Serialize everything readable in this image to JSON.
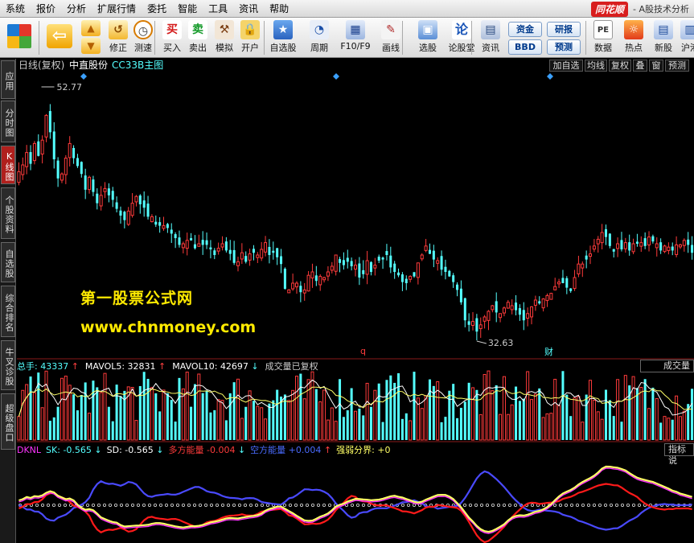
{
  "menu": [
    "系统",
    "报价",
    "分析",
    "扩展行情",
    "委托",
    "智能",
    "工具",
    "资讯",
    "帮助"
  ],
  "brand": {
    "logo": "同花顺",
    "subtitle": "- A股技术分析"
  },
  "toolbar": {
    "buttons": [
      {
        "label": "修正",
        "icon": "undo-icon"
      },
      {
        "label": "测速",
        "icon": "clock-icon"
      },
      {
        "label": "买入",
        "icon": "buy-icon",
        "glyph": "买"
      },
      {
        "label": "卖出",
        "icon": "sell-icon",
        "glyph": "卖"
      },
      {
        "label": "模拟",
        "icon": "hammer-icon"
      },
      {
        "label": "开户",
        "icon": "lock-icon"
      },
      {
        "label": "自选股",
        "icon": "star-folder-icon"
      },
      {
        "label": "周期",
        "icon": "cycle-icon"
      },
      {
        "label": "F10/F9",
        "icon": "f10-icon"
      },
      {
        "label": "画线",
        "icon": "pen-icon"
      },
      {
        "label": "选股",
        "icon": "monitor-icon"
      },
      {
        "label": "论股堂",
        "icon": "lun-icon",
        "glyph": "论"
      },
      {
        "label": "资讯",
        "icon": "info-icon"
      },
      {
        "label": "数据",
        "icon": "pe-icon",
        "glyph": "PE"
      },
      {
        "label": "热点",
        "icon": "hot-icon"
      },
      {
        "label": "新股",
        "icon": "ipo-icon"
      },
      {
        "label": "沪港",
        "icon": "hk-icon"
      }
    ],
    "small_buttons": [
      "资金",
      "BBD",
      "研报",
      "预测"
    ]
  },
  "left_tabs": [
    "应用",
    "分时图",
    "K线图",
    "个股资料",
    "自选股",
    "综合排名",
    "牛叉诊股",
    "超级盘口"
  ],
  "chart_header": {
    "period": "日线(复权)",
    "stock": "中直股份",
    "formula": "CC33B主图",
    "right_buttons": [
      "加自选",
      "均线",
      "复权",
      "叠",
      "窗",
      "预测"
    ]
  },
  "watermark": {
    "line1": "第一股票公式网",
    "line2": "www.chnmoney.com"
  },
  "volume_panel": {
    "items": [
      {
        "label": "总手: 43337",
        "arrow": "↑"
      },
      {
        "label": "MAVOL5: 32831",
        "arrow": "↑"
      },
      {
        "label": "MAVOL10: 42697",
        "arrow": "↓"
      },
      {
        "label": "成交量已复权",
        "arrow": ""
      }
    ],
    "tag": "成交量"
  },
  "dknl_panel": {
    "items": [
      {
        "label": "DKNL",
        "value": ""
      },
      {
        "label": "SK: ",
        "value": "-0.565",
        "arrow": "↓"
      },
      {
        "label": "SD: ",
        "value": "-0.565",
        "arrow": "↓"
      },
      {
        "label": "多方能量 ",
        "value": "-0.004",
        "arrow": "↓"
      },
      {
        "label": "空方能量 ",
        "value": "+0.004",
        "arrow": "↑"
      },
      {
        "label": "强弱分界: ",
        "value": "+0",
        "arrow": ""
      }
    ],
    "tag": "指标说"
  },
  "colors": {
    "up": "#ff3b3b",
    "down": "#54ffff",
    "ma5": "#ffffff",
    "ma10": "#ffff66",
    "dk_red": "#ff1a1a",
    "dk_blue": "#4a4aff",
    "dk_yellow": "#ffff66",
    "dk_magenta": "#ff33ff",
    "marker": "#3aa0ff"
  },
  "chart_data": {
    "type": "candlestick",
    "high_label": "52.77",
    "low_label": "32.63",
    "event_marks": [
      "q",
      "财"
    ],
    "ylim": [
      30.5,
      55.5
    ],
    "closes": [
      46.9,
      47.5,
      48.6,
      47.6,
      49.4,
      48.3,
      49.7,
      51.9,
      50.4,
      48.0,
      46.3,
      46.7,
      48.1,
      49.4,
      48.1,
      47.4,
      46.7,
      45.3,
      46.4,
      45.1,
      44.1,
      44.8,
      45.4,
      44.8,
      44.4,
      43.6,
      43.0,
      42.6,
      43.4,
      44.1,
      44.7,
      44.0,
      43.7,
      42.9,
      42.9,
      42.2,
      42.1,
      42.1,
      41.9,
      41.4,
      41.0,
      40.4,
      40.5,
      40.8,
      40.8,
      40.1,
      40.5,
      40.4,
      40.4,
      40.0,
      39.5,
      40.1,
      40.5,
      39.9,
      39.6,
      38.8,
      38.9,
      39.7,
      38.9,
      39.6,
      39.7,
      39.5,
      40.0,
      40.6,
      39.5,
      39.7,
      39.3,
      38.7,
      36.5,
      36.4,
      37.0,
      37.0,
      36.2,
      36.4,
      37.7,
      38.0,
      37.2,
      37.6,
      37.5,
      38.0,
      38.5,
      39.5,
      38.8,
      38.6,
      38.9,
      38.5,
      38.6,
      37.5,
      37.8,
      39.0,
      38.0,
      38.6,
      39.0,
      39.1,
      39.5,
      38.4,
      38.0,
      37.7,
      37.1,
      37.0,
      37.6,
      37.6,
      38.8,
      39.5,
      40.3,
      39.6,
      39.1,
      39.0,
      38.2,
      38.0,
      37.6,
      37.1,
      36.4,
      35.3,
      33.7,
      33.3,
      33.6,
      32.7,
      33.3,
      34.0,
      34.5,
      35.0,
      34.4,
      34.3,
      34.8,
      35.3,
      35.0,
      34.6,
      34.2,
      33.7,
      34.3,
      34.9,
      35.5,
      35.2,
      35.6,
      35.9,
      36.1,
      36.7,
      37.1,
      37.0,
      36.6,
      36.3,
      37.5,
      38.7,
      38.7,
      39.1,
      39.6,
      40.3,
      40.9,
      41.5,
      41.1,
      40.3,
      39.8,
      40.5,
      40.0,
      40.6,
      39.9,
      40.5,
      40.5,
      40.6,
      40.3,
      41.1,
      40.7,
      40.5,
      39.9,
      40.3,
      40.2,
      39.9,
      40.4,
      40.4,
      40.8,
      40.4,
      39.7
    ]
  }
}
